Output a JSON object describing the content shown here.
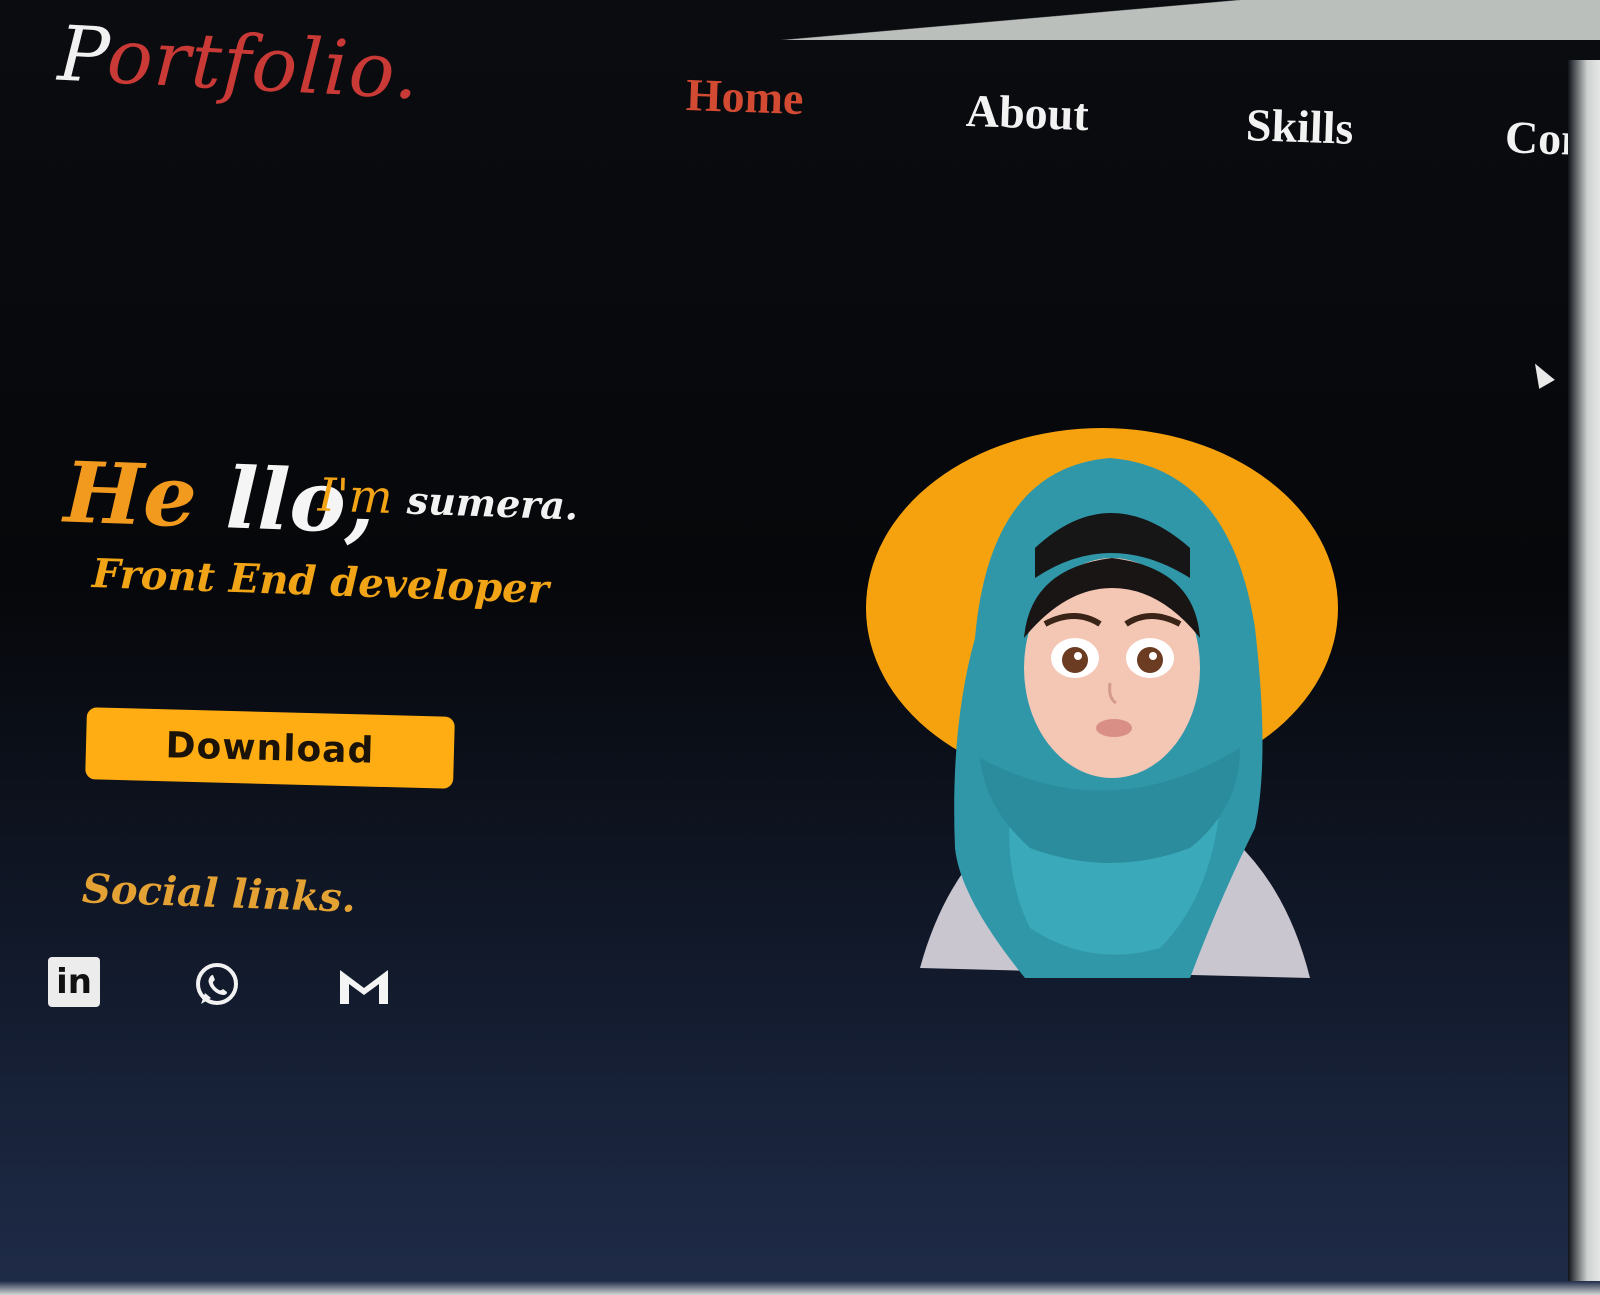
{
  "header": {
    "logo_first": "P",
    "logo_rest": "ortfolio."
  },
  "nav": {
    "items": [
      {
        "label": "Home",
        "active": true
      },
      {
        "label": "About",
        "active": false
      },
      {
        "label": "Skills",
        "active": false
      },
      {
        "label": "Cont",
        "active": false
      }
    ]
  },
  "hero": {
    "hello_a": "He",
    "hello_b": "llo,",
    "im": "I'm",
    "name": "sumera.",
    "role": "Front End developer",
    "download_label": "Download"
  },
  "social": {
    "title": "Social links.",
    "icons": [
      "linkedin-icon",
      "whatsapp-icon",
      "gmail-icon"
    ],
    "linkedin_text": "in"
  },
  "colors": {
    "accent_red": "#d34a33",
    "accent_orange": "#f19a1d",
    "button": "#ffad12",
    "hijab": "#2f97a8",
    "halo": "#f6a20f"
  }
}
